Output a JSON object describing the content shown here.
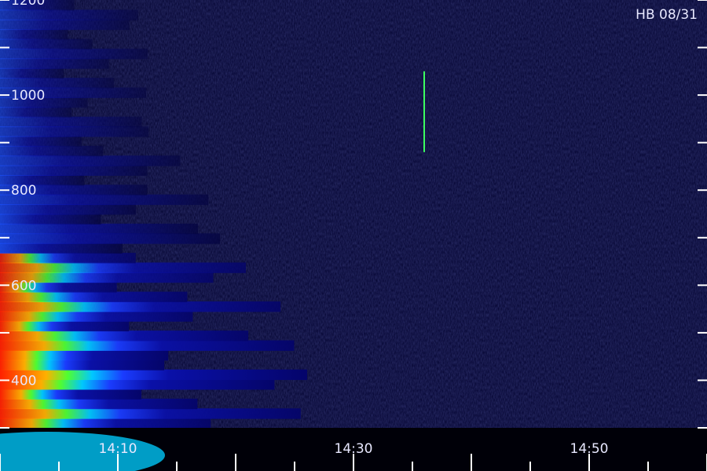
{
  "chart_data": {
    "type": "heatmap",
    "title": "HB 08/31",
    "xlabel": "",
    "ylabel": "",
    "x_range": [
      "14:00",
      "15:00"
    ],
    "y_range": [
      300,
      1200
    ],
    "x_ticks": [
      "14:10",
      "14:30",
      "14:50"
    ],
    "y_ticks": [
      "400",
      "600",
      "800",
      "1000",
      "1200"
    ],
    "colormap": [
      "#000010",
      "#0a14c8",
      "#2860ff",
      "#00d2ff",
      "#28ff4a",
      "#f0ff00",
      "#ff6000",
      "#ff1000"
    ],
    "features": [
      {
        "name": "broadband emission fading from 14:00 to about 14:25",
        "peak_y": 400,
        "peak_level": 1.0
      },
      {
        "name": "narrow vertical burst",
        "time": "14:36",
        "y_from": 880,
        "y_to": 1050
      }
    ]
  }
}
